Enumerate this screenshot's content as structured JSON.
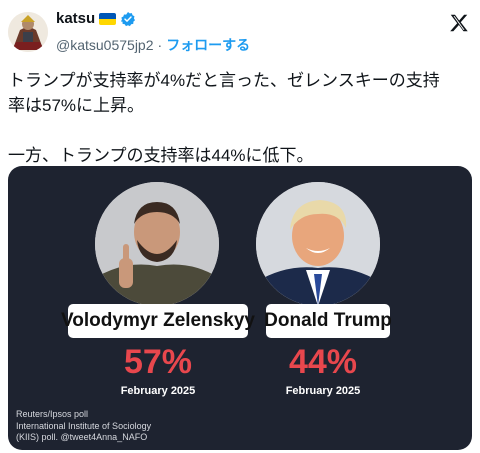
{
  "author": {
    "display_name": "katsu",
    "handle": "@katsu0575jp2",
    "separator": "·",
    "follow_label": "フォローする"
  },
  "tweet": {
    "line1": "トランプが支持率が4%だと言った、ゼレンスキーの支持",
    "line2": "率は57%に上昇。",
    "line3": "一方、トランプの支持率は44%に低下。"
  },
  "card": {
    "left": {
      "name": "Volodymyr Zelenskyy",
      "percent": "57%",
      "date": "February 2025"
    },
    "right": {
      "name": "Donald Trump",
      "percent": "44%",
      "date": "February 2025"
    },
    "source": {
      "line1": "Reuters/Ipsos poll",
      "line2": "International Institute of Sociology",
      "line3": "(KIIS) poll. @tweet4Anna_NAFO"
    }
  },
  "colors": {
    "card_background": "#1e2330",
    "percent_red": "#e8474d",
    "follow_blue": "#1d9bf0",
    "verified_blue": "#1d9bf0"
  },
  "icons": {
    "verified": "verified-badge-icon",
    "flag": "ukraine-flag-icon",
    "platform": "x-logo-icon"
  }
}
